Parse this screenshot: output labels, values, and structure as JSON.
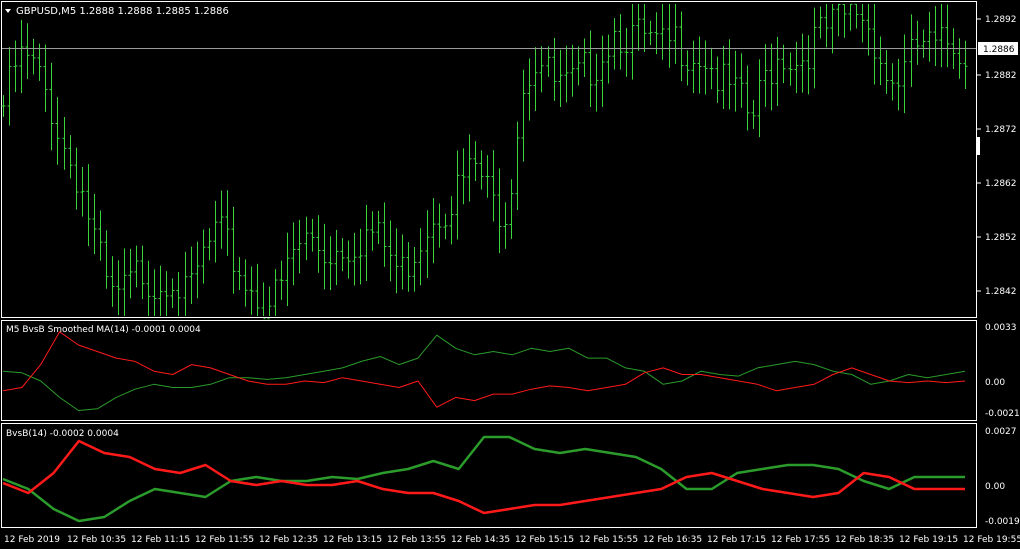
{
  "main_panel": {
    "title": "GBPUSD,M5  1.2888 1.2888 1.2885 1.2886",
    "current_price": "1.2886",
    "price_labels": [
      "1.2892",
      "1.2882",
      "1.2872",
      "1.2862",
      "1.2852",
      "1.2842"
    ]
  },
  "indicator1": {
    "title": "M5 BvsB Smoothed MA(14) -0.0001 0.0004",
    "scale_labels": [
      "0.0033",
      "0.00",
      "-0.0021"
    ]
  },
  "indicator2": {
    "title": "BvsB(14) -0.0002 0.0004",
    "scale_labels": [
      "0.0027",
      "0.00",
      "-0.0019"
    ]
  },
  "time_labels": [
    "12 Feb 2019",
    "12 Feb 10:35",
    "12 Feb 11:15",
    "12 Feb 11:55",
    "12 Feb 12:35",
    "12 Feb 13:15",
    "12 Feb 13:55",
    "12 Feb 14:35",
    "12 Feb 15:15",
    "12 Feb 15:55",
    "12 Feb 16:35",
    "12 Feb 17:15",
    "12 Feb 17:55",
    "12 Feb 18:35",
    "12 Feb 19:15",
    "12 Feb 19:55"
  ],
  "colors": {
    "background": "#000000",
    "bars": "#3ad33a",
    "bull_line": "#2b9b2b",
    "bear_line": "#ff1a1a",
    "grid_border": "#ffffff"
  },
  "chart_data": {
    "type": "line",
    "price_path": [
      1.2876,
      1.2885,
      1.2883,
      1.2877,
      1.2868,
      1.2862,
      1.2851,
      1.284,
      1.2842,
      1.2846,
      1.2843,
      1.2846,
      1.284,
      1.2848,
      1.2853,
      1.2848,
      1.2843,
      1.284,
      1.2841,
      1.2849,
      1.2852,
      1.2849,
      1.285,
      1.2851,
      1.2853,
      1.285,
      1.2845,
      1.285,
      1.2856,
      1.2858,
      1.2862,
      1.2865,
      1.2858,
      1.2857,
      1.288,
      1.2885,
      1.288,
      1.2879,
      1.2882,
      1.2885,
      1.289,
      1.2889,
      1.2888,
      1.2886,
      1.2888,
      1.2886,
      1.2885,
      1.288,
      1.2878,
      1.2873,
      1.2882,
      1.2886,
      1.2884,
      1.2888,
      1.289,
      1.2892,
      1.2894,
      1.2889,
      1.288,
      1.2882,
      1.2888,
      1.2886,
      1.2888,
      1.2886
    ],
    "smoothed_bull": [
      0.0006,
      0.0005,
      0.0,
      -0.001,
      -0.0018,
      -0.0017,
      -0.001,
      -0.0005,
      -0.0002,
      -0.0004,
      -0.0004,
      -0.0002,
      0.0002,
      0.0002,
      0.0001,
      0.0002,
      0.0004,
      0.0006,
      0.0008,
      0.0012,
      0.0015,
      0.001,
      0.0014,
      0.0028,
      0.002,
      0.0016,
      0.0018,
      0.0016,
      0.002,
      0.0018,
      0.002,
      0.0014,
      0.0014,
      0.0008,
      0.0006,
      -0.0002,
      0.0,
      0.0006,
      0.0004,
      0.0003,
      0.0008,
      0.001,
      0.0012,
      0.001,
      0.0006,
      0.0004,
      -0.0002,
      0.0,
      0.0004,
      0.0002,
      0.0004,
      0.0006
    ],
    "smoothed_bear": [
      -0.0006,
      -0.0004,
      0.001,
      0.003,
      0.0022,
      0.0018,
      0.0014,
      0.0012,
      0.0006,
      0.0004,
      0.001,
      0.0008,
      0.0004,
      0.0,
      -0.0002,
      -0.0002,
      0.0,
      -0.0001,
      0.0002,
      0.0,
      -0.0002,
      -0.0004,
      0.0,
      -0.0016,
      -0.001,
      -0.0012,
      -0.0008,
      -0.0008,
      -0.0005,
      -0.0003,
      -0.0004,
      -0.0006,
      -0.0004,
      -0.0002,
      0.0005,
      0.0008,
      0.0004,
      0.0004,
      0.0002,
      0.0,
      -0.0002,
      -0.0006,
      -0.0004,
      -0.0002,
      0.0004,
      0.0008,
      0.0004,
      0.0,
      -0.0001,
      0.0,
      -0.0001,
      0.0
    ],
    "bvsb_bull": [
      0.0003,
      -0.0002,
      -0.0012,
      -0.0018,
      -0.0016,
      -0.0008,
      -0.0002,
      -0.0004,
      -0.0006,
      0.0002,
      0.0004,
      0.0002,
      0.0002,
      0.0004,
      0.0003,
      0.0006,
      0.0008,
      0.0012,
      0.0008,
      0.0024,
      0.0024,
      0.0018,
      0.0016,
      0.0018,
      0.0016,
      0.0014,
      0.0008,
      -0.0002,
      -0.0002,
      0.0006,
      0.0008,
      0.001,
      0.001,
      0.0008,
      0.0002,
      -0.0002,
      0.0004,
      0.0004,
      0.0004
    ],
    "bvsb_bear": [
      0.0001,
      -0.0004,
      0.0006,
      0.0022,
      0.0016,
      0.0014,
      0.0008,
      0.0006,
      0.001,
      0.0002,
      0.0,
      0.0002,
      0.0,
      0.0,
      0.0002,
      -0.0002,
      -0.0004,
      -0.0004,
      -0.0008,
      -0.0014,
      -0.0012,
      -0.001,
      -0.001,
      -0.0008,
      -0.0006,
      -0.0004,
      -0.0002,
      0.0004,
      0.0006,
      0.0002,
      -0.0002,
      -0.0004,
      -0.0006,
      -0.0004,
      0.0006,
      0.0004,
      -0.0002,
      -0.0002,
      -0.0002
    ]
  }
}
